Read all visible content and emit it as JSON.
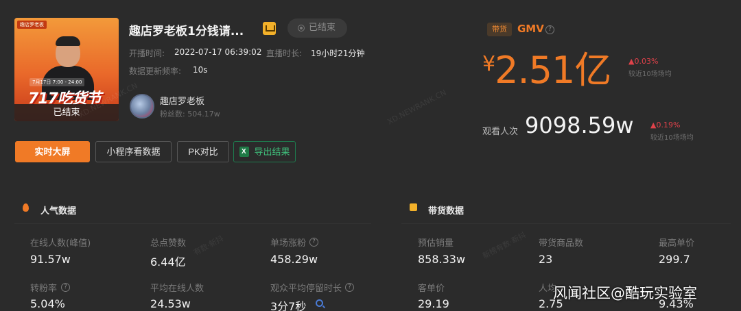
{
  "thumbnail": {
    "tag": "趣店罗老板",
    "date": "7月17日 7:00 - 24:00",
    "promo": "717吃货节",
    "status": "已结束"
  },
  "live": {
    "title": "趣店罗老板1分钱请...",
    "status_pill": "已结束",
    "start_time_label": "开播时间:",
    "start_time": "2022-07-17 06:39:02",
    "duration_label": "直播时长:",
    "duration": "19小时21分钟",
    "refresh_label": "数据更新频率:",
    "refresh": "10s"
  },
  "anchor": {
    "name": "趣店罗老板",
    "fans": "粉丝数: 504.17w"
  },
  "actions": {
    "realtime": "实时大屏",
    "mini_program": "小程序看数据",
    "pk": "PK对比",
    "export": "导出结果"
  },
  "gmv": {
    "tag": "带货",
    "label": "GMV",
    "currency": "¥",
    "value": "2.51亿",
    "change": "▲0.03%",
    "change_note": "较近10场场均"
  },
  "viewers": {
    "label": "观看人次",
    "value": "9098.59w",
    "change": "▲0.19%",
    "change_note": "较近10场场均"
  },
  "popularity": {
    "title": "人气数据",
    "stats": [
      {
        "label": "在线人数(峰值)",
        "value": "91.57w"
      },
      {
        "label": "总点赞数",
        "value": "6.44亿"
      },
      {
        "label": "单场涨粉",
        "value": "458.29w"
      },
      {
        "label": "转粉率",
        "value": "5.04%"
      },
      {
        "label": "平均在线人数",
        "value": "24.53w"
      },
      {
        "label": "观众平均停留时长",
        "value": "3分7秒"
      }
    ]
  },
  "sales": {
    "title": "带货数据",
    "stats": [
      {
        "label": "预估销量",
        "value": "858.33w"
      },
      {
        "label": "带货商品数",
        "value": "23"
      },
      {
        "label": "最高单价",
        "value": "299.7"
      },
      {
        "label": "客单价",
        "value": "29.19"
      },
      {
        "label": "人均",
        "value": "2.75"
      },
      {
        "label": "",
        "value": "9.43%"
      }
    ]
  },
  "watermarks": [
    "XD.NEWRANK.CN",
    "有数·新抖",
    "新榜有数·新抖"
  ],
  "credit": "风闻社区@酷玩实验室"
}
